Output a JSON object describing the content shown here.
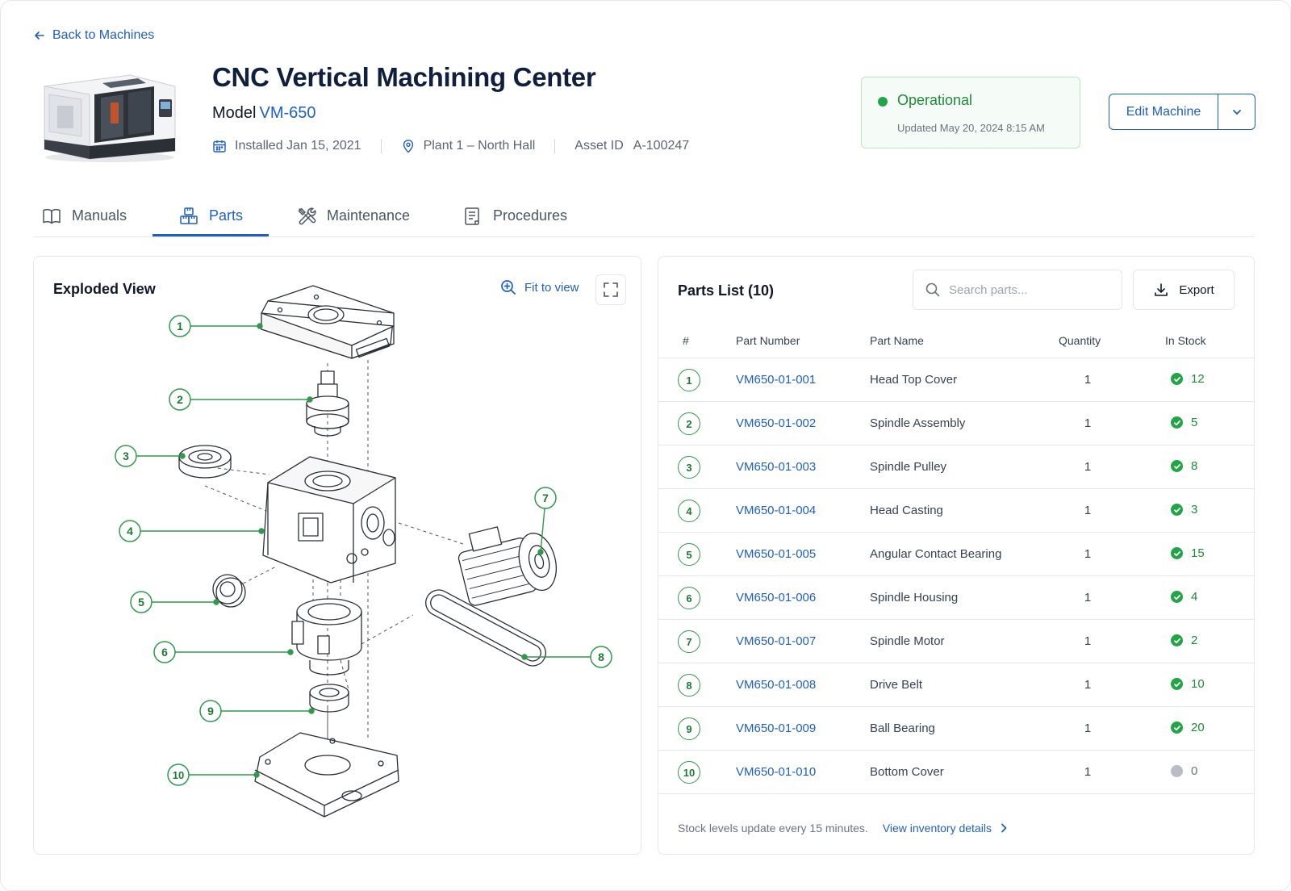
{
  "nav": {
    "back_label": "Back to Machines"
  },
  "machine": {
    "title": "CNC Vertical Machining Center",
    "model_label": "Model",
    "model_value": "VM-650",
    "installed": "Installed Jan 15, 2021",
    "location": "Plant 1 – North Hall",
    "asset_label": "Asset ID",
    "asset_value": "A-100247"
  },
  "status": {
    "label": "Operational",
    "updated": "Updated May 20, 2024  8:15 AM",
    "color": "#22a447"
  },
  "actions": {
    "edit_label": "Edit Machine"
  },
  "tabs": [
    {
      "label": "Manuals",
      "icon": "book-icon",
      "active": false
    },
    {
      "label": "Parts",
      "icon": "parts-icon",
      "active": true
    },
    {
      "label": "Maintenance",
      "icon": "tools-icon",
      "active": false
    },
    {
      "label": "Procedures",
      "icon": "document-icon",
      "active": false
    }
  ],
  "exploded_view": {
    "title": "Exploded View",
    "fit_label": "Fit to view",
    "callouts": [
      "1",
      "2",
      "3",
      "4",
      "5",
      "6",
      "7",
      "8",
      "9",
      "10"
    ]
  },
  "parts": {
    "title": "Parts List (10)",
    "search_placeholder": "Search parts...",
    "export_label": "Export",
    "columns": [
      "#",
      "Part Number",
      "Part Name",
      "Quantity",
      "In Stock"
    ],
    "rows": [
      {
        "num": "1",
        "part_number": "VM650-01-001",
        "name": "Head Top Cover",
        "qty": "1",
        "stock": "12",
        "in_stock": true
      },
      {
        "num": "2",
        "part_number": "VM650-01-002",
        "name": "Spindle Assembly",
        "qty": "1",
        "stock": "5",
        "in_stock": true
      },
      {
        "num": "3",
        "part_number": "VM650-01-003",
        "name": "Spindle Pulley",
        "qty": "1",
        "stock": "8",
        "in_stock": true
      },
      {
        "num": "4",
        "part_number": "VM650-01-004",
        "name": "Head Casting",
        "qty": "1",
        "stock": "3",
        "in_stock": true
      },
      {
        "num": "5",
        "part_number": "VM650-01-005",
        "name": "Angular Contact Bearing",
        "qty": "1",
        "stock": "15",
        "in_stock": true
      },
      {
        "num": "6",
        "part_number": "VM650-01-006",
        "name": "Spindle Housing",
        "qty": "1",
        "stock": "4",
        "in_stock": true
      },
      {
        "num": "7",
        "part_number": "VM650-01-007",
        "name": "Spindle Motor",
        "qty": "1",
        "stock": "2",
        "in_stock": true
      },
      {
        "num": "8",
        "part_number": "VM650-01-008",
        "name": "Drive Belt",
        "qty": "1",
        "stock": "10",
        "in_stock": true
      },
      {
        "num": "9",
        "part_number": "VM650-01-009",
        "name": "Ball Bearing",
        "qty": "1",
        "stock": "20",
        "in_stock": true
      },
      {
        "num": "10",
        "part_number": "VM650-01-010",
        "name": "Bottom Cover",
        "qty": "1",
        "stock": "0",
        "in_stock": false
      }
    ],
    "footer_note": "Stock levels update every 15 minutes.",
    "footer_link": "View inventory details"
  },
  "colors": {
    "accent": "#1f5fbf",
    "success": "#22a447",
    "muted": "#b8bcc4"
  }
}
